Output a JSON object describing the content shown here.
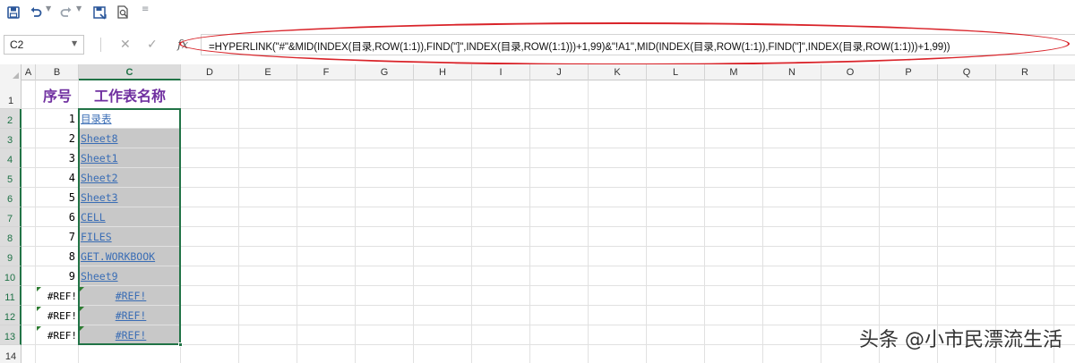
{
  "toolbar": {
    "save_icon": "save-icon",
    "undo_icon": "undo-icon",
    "redo_icon": "redo-icon",
    "print_icon": "print-icon",
    "preview_icon": "print-preview-icon",
    "more_icon": "customize-toolbar-icon"
  },
  "formula_bar": {
    "name_box": "C2",
    "fx_label": "fx",
    "formula": "=HYPERLINK(\"#\"&MID(INDEX(目录,ROW(1:1)),FIND(\"]\",INDEX(目录,ROW(1:1)))+1,99)&\"!A1\",MID(INDEX(目录,ROW(1:1)),FIND(\"]\",INDEX(目录,ROW(1:1)))+1,99))"
  },
  "grid": {
    "columns": [
      "A",
      "B",
      "C",
      "D",
      "E",
      "F",
      "G",
      "H",
      "I",
      "J",
      "K",
      "L",
      "M",
      "N",
      "O",
      "P",
      "Q",
      "R"
    ],
    "rows": [
      "1",
      "2",
      "3",
      "4",
      "5",
      "6",
      "7",
      "8",
      "9",
      "10",
      "11",
      "12",
      "13",
      "14"
    ],
    "header_b": "序号",
    "header_c": "工作表名称",
    "seq": [
      "1",
      "2",
      "3",
      "4",
      "5",
      "6",
      "7",
      "8",
      "9",
      "#REF!",
      "#REF!",
      "#REF!"
    ],
    "names": [
      "目录表",
      "Sheet8",
      "Sheet1",
      "Sheet2",
      "Sheet3",
      "CELL",
      "FILES",
      "GET.WORKBOOK",
      "Sheet9",
      "#REF!",
      "#REF!",
      "#REF!"
    ]
  },
  "colors": {
    "header_text": "#7030a0",
    "link": "#3a6db5",
    "selection": "#217346",
    "callout": "#d9242a"
  },
  "watermark": "头条 @小市民漂流生活"
}
